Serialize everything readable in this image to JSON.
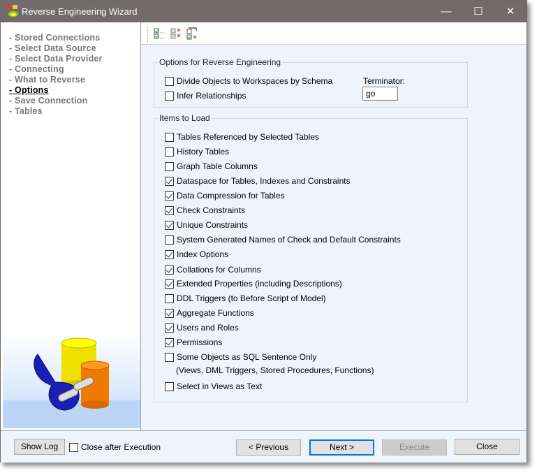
{
  "window": {
    "title": "Reverse Engineering Wizard",
    "minimize": "—",
    "maximize": "☐",
    "close": "✕"
  },
  "steps": [
    {
      "label": "- Stored Connections",
      "current": false
    },
    {
      "label": "- Select Data Source",
      "current": false
    },
    {
      "label": "- Select Data Provider",
      "current": false
    },
    {
      "label": "- Connecting",
      "current": false
    },
    {
      "label": "- What to Reverse",
      "current": false
    },
    {
      "label": "- Options",
      "current": true
    },
    {
      "label": "- Save Connection",
      "current": false
    },
    {
      "label": "- Tables",
      "current": false
    }
  ],
  "toolbar": [
    "check-all-icon",
    "uncheck-all-icon",
    "invert-selection-icon"
  ],
  "options": {
    "legend": "Options for Reverse Engineering",
    "items": [
      {
        "label": "Divide Objects to Workspaces by Schema",
        "checked": false
      },
      {
        "label": "Infer Relationships",
        "checked": false
      }
    ],
    "terminator_label": "Terminator:",
    "terminator_value": "go"
  },
  "items_to_load": {
    "legend": "Items to Load",
    "items": [
      {
        "label": "Tables Referenced by Selected Tables",
        "checked": false
      },
      {
        "label": "History Tables",
        "checked": false
      },
      {
        "label": "Graph Table Columns",
        "checked": false
      },
      {
        "label": "Dataspace for Tables, Indexes and Constraints",
        "checked": true
      },
      {
        "label": "Data Compression for Tables",
        "checked": true
      },
      {
        "label": "Check Constraints",
        "checked": true
      },
      {
        "label": "Unique Constraints",
        "checked": true
      },
      {
        "label": "System Generated Names of Check and Default Constraints",
        "checked": false
      },
      {
        "label": "Index Options",
        "checked": true
      },
      {
        "label": "Collations for Columns",
        "checked": true
      },
      {
        "label": "Extended Properties (including Descriptions)",
        "checked": true
      },
      {
        "label": "DDL Triggers (to Before Script of Model)",
        "checked": false
      },
      {
        "label": "Aggregate Functions",
        "checked": true
      },
      {
        "label": "Users and Roles",
        "checked": true
      },
      {
        "label": "Permissions",
        "checked": true
      },
      {
        "label": "Some Objects as SQL Sentence Only",
        "checked": false
      },
      {
        "label": "Select in Views as Text",
        "checked": false
      }
    ],
    "note": "(Views, DML Triggers, Stored Procedures, Functions)"
  },
  "footer": {
    "show_log": "Show Log",
    "close_after": "Close after Execution",
    "close_after_checked": false,
    "previous": "< Previous",
    "next": "Next >",
    "execute": "Execute",
    "close": "Close"
  }
}
